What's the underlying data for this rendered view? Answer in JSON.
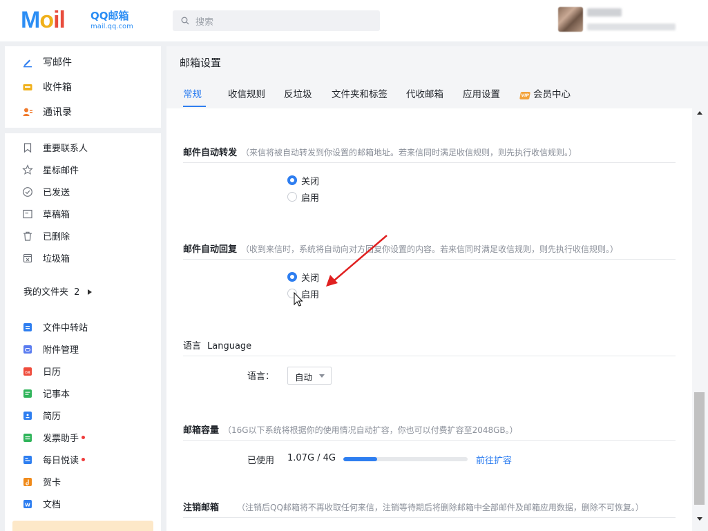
{
  "header": {
    "logo": {
      "main": "M",
      "o": "o",
      "il": "il",
      "sub1": "QQ邮箱",
      "sub2": "mail.qq.com"
    },
    "search_placeholder": "搜索"
  },
  "sidebar": {
    "primary": [
      {
        "label": "写邮件",
        "icon": "pencil-icon",
        "color": "#2e7ef0"
      },
      {
        "label": "收件箱",
        "icon": "inbox-icon",
        "color": "#f0b01a"
      },
      {
        "label": "通讯录",
        "icon": "contacts-icon",
        "color": "#f07a2c"
      }
    ],
    "folders": [
      {
        "label": "重要联系人",
        "icon": "bookmark-icon"
      },
      {
        "label": "星标邮件",
        "icon": "star-icon"
      },
      {
        "label": "已发送",
        "icon": "check-circle-icon"
      },
      {
        "label": "草稿箱",
        "icon": "draft-icon"
      },
      {
        "label": "已删除",
        "icon": "trash-icon"
      },
      {
        "label": "垃圾箱",
        "icon": "spam-icon"
      }
    ],
    "my_folders": {
      "label": "我的文件夹",
      "count": "2"
    },
    "apps": [
      {
        "label": "文件中转站",
        "icon": "file-transfer-icon",
        "color": "#2e7ef0",
        "badge": false
      },
      {
        "label": "附件管理",
        "icon": "attachment-icon",
        "color": "#5a7cf0",
        "badge": false
      },
      {
        "label": "日历",
        "icon": "calendar-icon",
        "color": "#ef4b3b",
        "badge": false
      },
      {
        "label": "记事本",
        "icon": "notebook-icon",
        "color": "#2fb45a",
        "badge": false
      },
      {
        "label": "简历",
        "icon": "resume-icon",
        "color": "#2e7ef0",
        "badge": false
      },
      {
        "label": "发票助手",
        "icon": "invoice-icon",
        "color": "#2fb45a",
        "badge": true
      },
      {
        "label": "每日悦读",
        "icon": "reading-icon",
        "color": "#2e7ef0",
        "badge": true
      },
      {
        "label": "贺卡",
        "icon": "card-icon",
        "color": "#f08a1a",
        "badge": false
      },
      {
        "label": "文档",
        "icon": "document-icon",
        "color": "#2e7ef0",
        "badge": false
      }
    ]
  },
  "main": {
    "title": "邮箱设置",
    "tabs": [
      "常规",
      "收信规则",
      "反垃圾",
      "文件夹和标签",
      "代收邮箱",
      "应用设置",
      "会员中心"
    ],
    "active_tab": "常规",
    "vip_badge": "VIP",
    "sections": {
      "auto_forward": {
        "title": "邮件自动转发",
        "desc": "（来信将被自动转发到你设置的邮箱地址。若来信同时满足收信规则，则先执行收信规则。）",
        "options": [
          "关闭",
          "启用"
        ],
        "selected": "关闭"
      },
      "auto_reply": {
        "title": "邮件自动回复",
        "desc": "（收到来信时，系统将自动向对方回复你设置的内容。若来信同时满足收信规则，则先执行收信规则。）",
        "options": [
          "关闭",
          "启用"
        ],
        "selected": "关闭"
      },
      "language": {
        "title": "语言",
        "title_en": "Language",
        "label": "语言：",
        "value": "自动"
      },
      "storage": {
        "title": "邮箱容量",
        "desc": "（16G以下系统将根据你的使用情况自动扩容，你也可以付费扩容至2048GB。）",
        "used_label": "已使用",
        "used_value": "1.07G / 4G",
        "used_fraction": 0.27,
        "expand_link": "前往扩容"
      },
      "close_account": {
        "title": "注销邮箱",
        "desc": "（注销后QQ邮箱将不再收取任何来信，注销等待期后将删除邮箱中全部邮件及邮箱应用数据，删除不可恢复。）"
      }
    }
  },
  "colors": {
    "accent": "#2e7ef0",
    "annotation_arrow": "#e02020"
  }
}
